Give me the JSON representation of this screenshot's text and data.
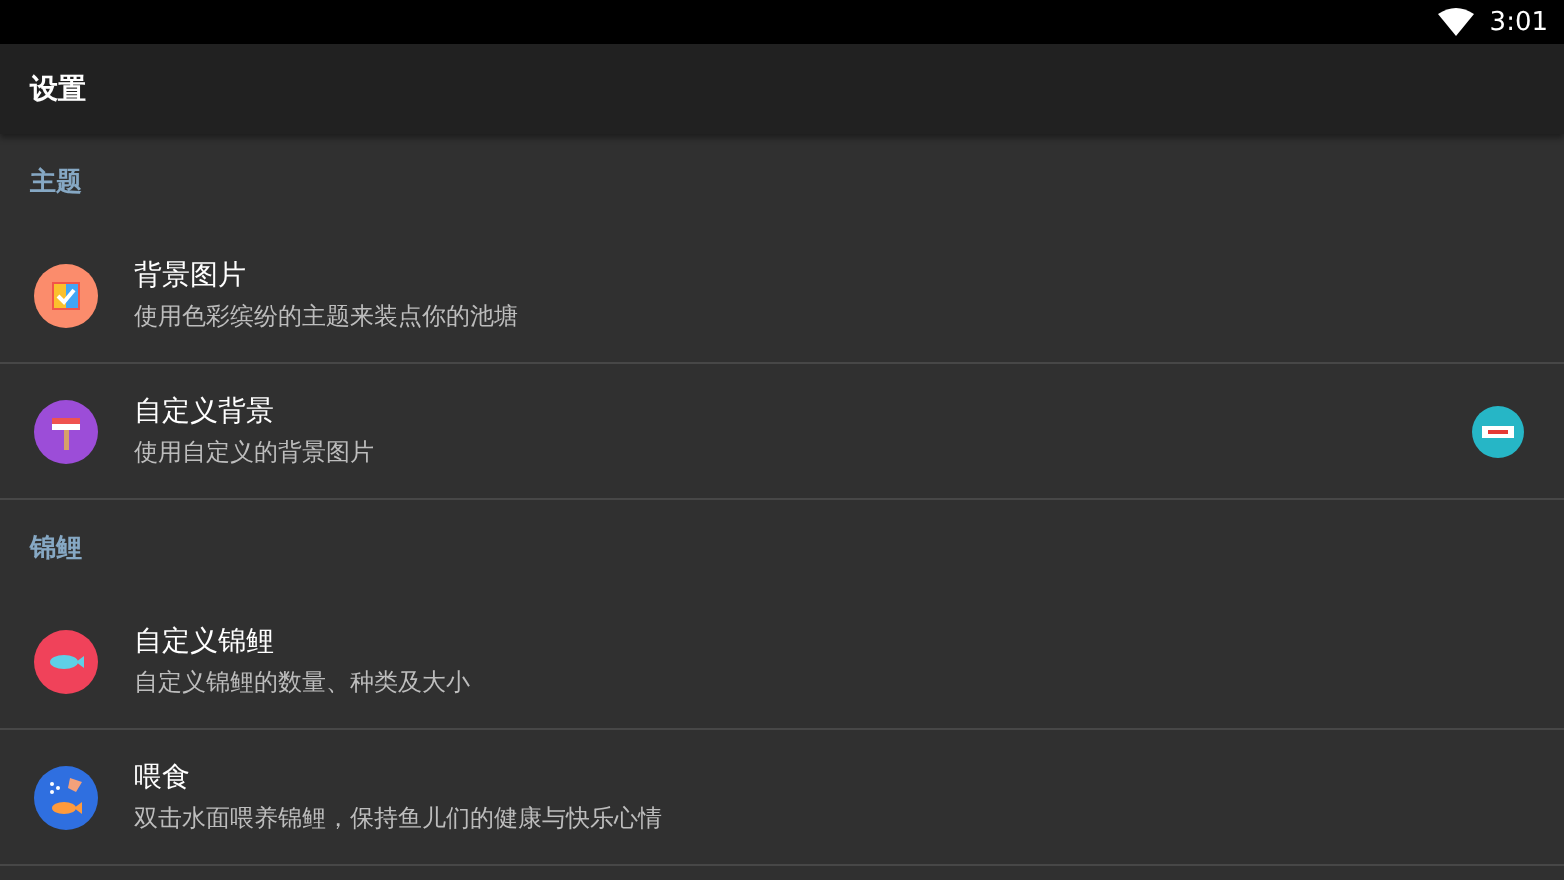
{
  "status_bar": {
    "time": "3:01"
  },
  "app_bar": {
    "title": "设置"
  },
  "sections": [
    {
      "header": "主题",
      "items": [
        {
          "kind": "picture",
          "title": "背景图片",
          "subtitle": "使用色彩缤纷的主题来装点你的池塘",
          "purchasable": false
        },
        {
          "kind": "brush",
          "title": "自定义背景",
          "subtitle": "使用自定义的背景图片",
          "purchasable": true
        }
      ]
    },
    {
      "header": "锦鲤",
      "items": [
        {
          "kind": "fish",
          "title": "自定义锦鲤",
          "subtitle": "自定义锦鲤的数量、种类及大小",
          "purchasable": false
        },
        {
          "kind": "feed",
          "title": "喂食",
          "subtitle": "双击水面喂养锦鲤，保持鱼儿们的健康与快乐心情",
          "purchasable": false
        }
      ]
    }
  ]
}
